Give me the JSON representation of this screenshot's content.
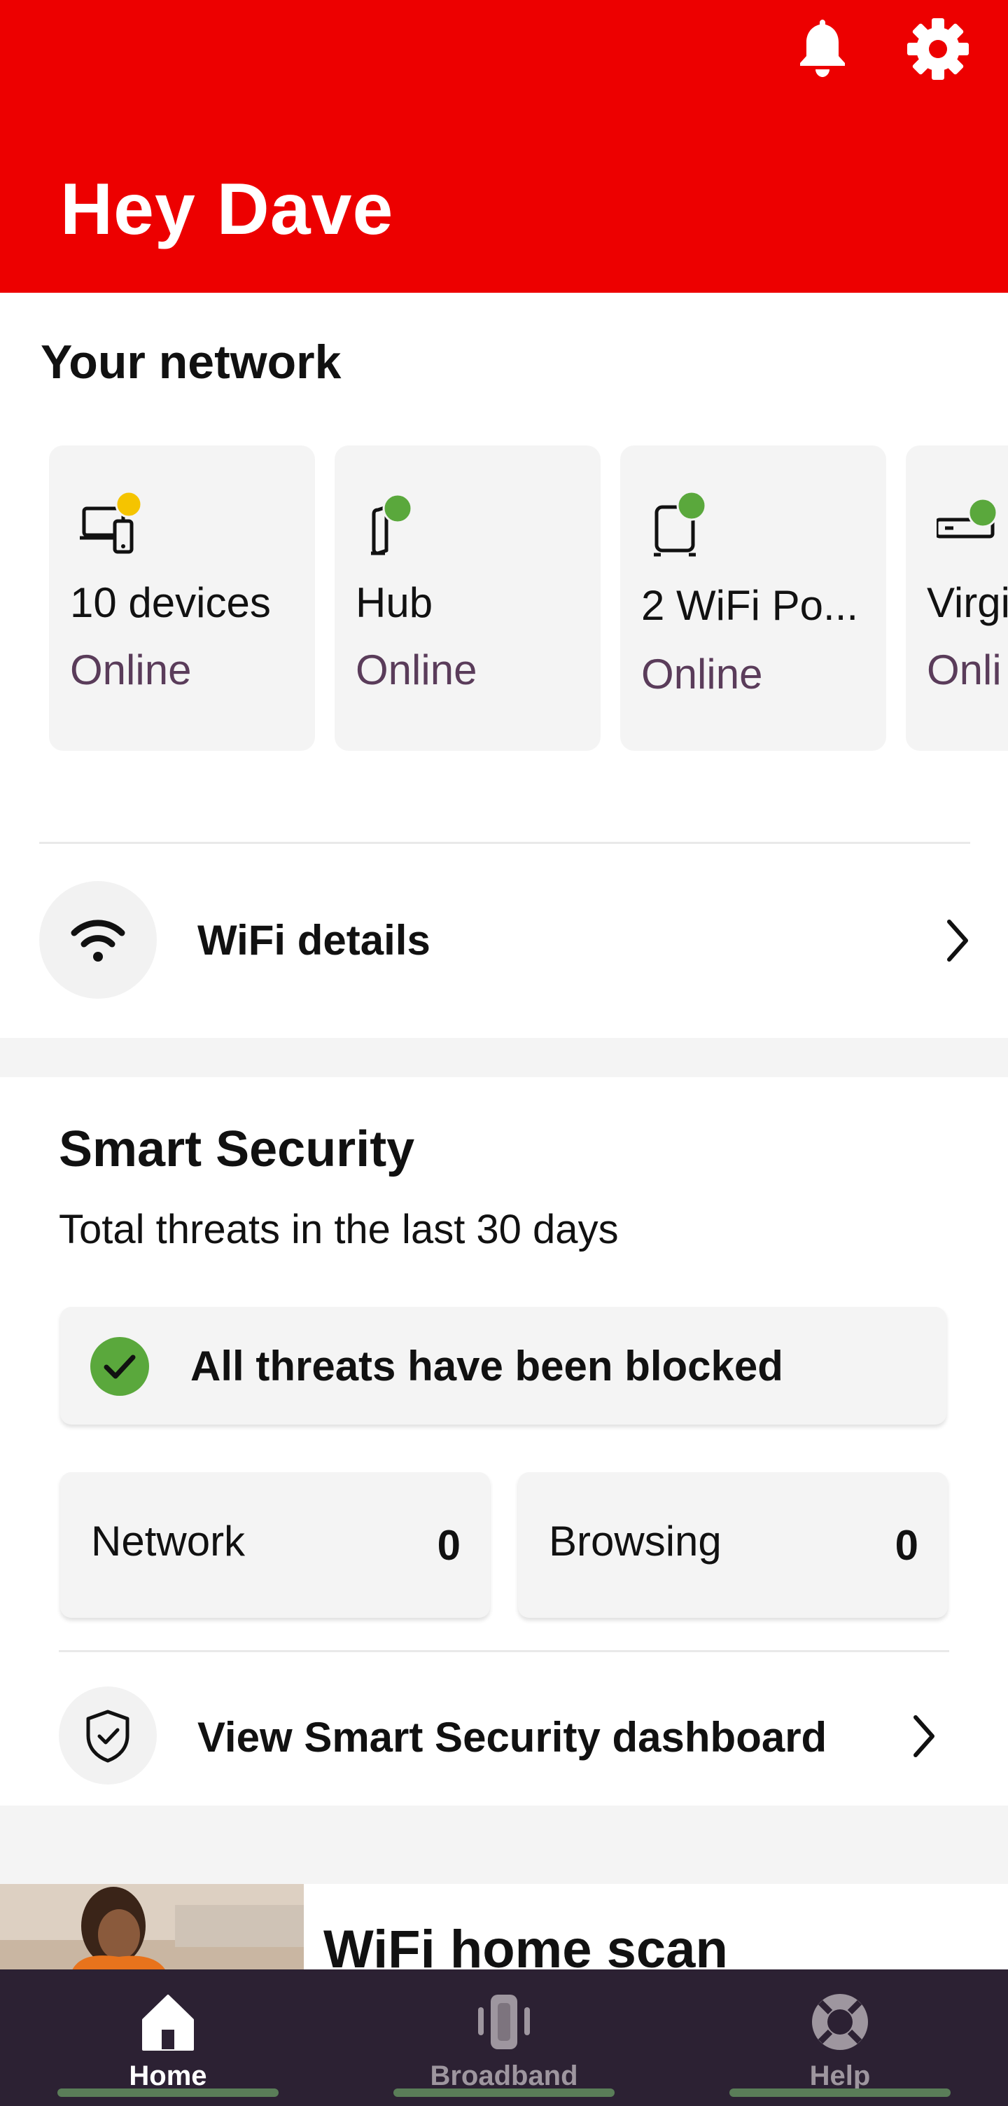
{
  "header": {
    "greeting": "Hey Dave",
    "background_color": "#ed0000"
  },
  "network": {
    "title": "Your network",
    "cards": [
      {
        "name": "10 devices",
        "status": "Online",
        "icon": "laptop-phone-icon",
        "dot_color": "#f5c400"
      },
      {
        "name": "Hub",
        "status": "Online",
        "icon": "hub-icon",
        "dot_color": "#5aa83c"
      },
      {
        "name": "2 WiFi Po...",
        "status": "Online",
        "icon": "wifi-pod-icon",
        "dot_color": "#5aa83c"
      },
      {
        "name": "Virgi",
        "status": "Onli",
        "icon": "set-top-box-icon",
        "dot_color": "#5aa83c"
      }
    ],
    "wifi_details": {
      "label": "WiFi details"
    }
  },
  "security": {
    "title": "Smart Security",
    "subtitle": "Total threats in the last 30 days",
    "blocked_label": "All threats have been blocked",
    "stats": [
      {
        "label": "Network",
        "value": "0"
      },
      {
        "label": "Browsing",
        "value": "0"
      }
    ],
    "dashboard_label": "View Smart Security dashboard"
  },
  "promo": {
    "title": "WiFi home scan"
  },
  "bottom_nav": {
    "items": [
      {
        "label": "Home",
        "icon": "home-icon",
        "active": true
      },
      {
        "label": "Broadband",
        "icon": "broadband-icon",
        "active": false
      },
      {
        "label": "Help",
        "icon": "help-lifebuoy-icon",
        "active": false
      }
    ],
    "active_color": "#ffffff",
    "inactive_color": "#9e969f"
  },
  "colors": {
    "status_purple": "#5a3c5a",
    "online_green": "#5aa83c",
    "warning_yellow": "#f5c400"
  }
}
